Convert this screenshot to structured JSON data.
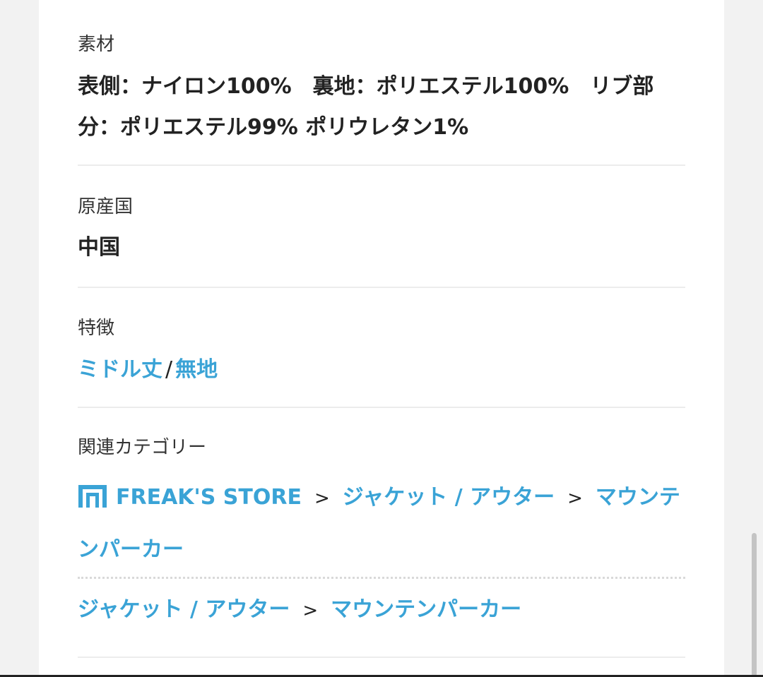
{
  "material": {
    "label": "素材",
    "value": "表側：ナイロン100%　裏地：ポリエステル100%　リブ部分：ポリエステル99% ポリウレタン1%"
  },
  "origin": {
    "label": "原産国",
    "value": "中国"
  },
  "features": {
    "label": "特徴",
    "items": [
      "ミドル丈",
      "無地"
    ],
    "separator": "/"
  },
  "related": {
    "label": "関連カテゴリー",
    "breadcrumb1": {
      "icon": "shop-icon",
      "items": [
        "FREAK'S STORE",
        "ジャケット / アウター",
        "マウンテンパーカー"
      ]
    },
    "breadcrumb2": {
      "items": [
        "ジャケット / アウター",
        "マウンテンパーカー"
      ]
    },
    "arrow": ">"
  },
  "colors": {
    "link": "#3aa3d6",
    "text": "#222222",
    "divider": "#ececec"
  }
}
